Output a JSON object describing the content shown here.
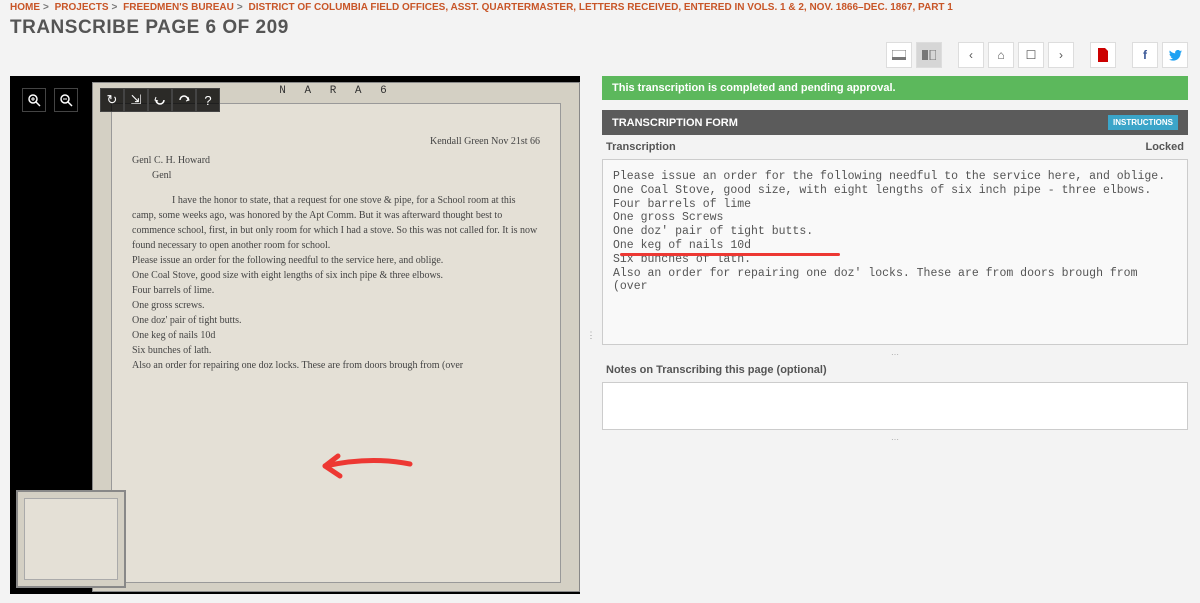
{
  "breadcrumb": {
    "items": [
      "HOME",
      "PROJECTS",
      "FREEDMEN'S BUREAU",
      "DISTRICT OF COLUMBIA FIELD OFFICES, ASST. QUARTERMASTER, LETTERS RECEIVED, ENTERED IN VOLS. 1 & 2, NOV. 1866–DEC. 1867, PART 1"
    ]
  },
  "page_title": "TRANSCRIBE PAGE 6 OF 209",
  "status": "This transcription is completed and pending approval.",
  "form_header": "TRANSCRIPTION FORM",
  "instructions_label": "INSTRUCTIONS",
  "field_label": "Transcription",
  "locked_label": "Locked",
  "notes_label": "Notes on Transcribing this page (optional)",
  "transcription_text": "Please issue an order for the following needful to the service here, and oblige.\nOne Coal Stove, good size, with eight lengths of six inch pipe - three elbows.\nFour barrels of lime\nOne gross Screws\nOne doz' pair of tight butts.\nOne keg of nails 10d\nSix bunches of lath.\nAlso an order for repairing one doz' locks. These are from doors brough from\n(over",
  "doc": {
    "nara": "N A R A       6",
    "date_line": "Kendall Green Nov 21st 66",
    "addressee": "Genl C. H. Howard",
    "title": "Genl",
    "opening": "I have the honor to",
    "body": "state, that a request for one stove & pipe, for a School room at this camp, some weeks ago, was honored by the Apt Comm. But it was afterward thought best to commence school, first, in but only room for which I had a stove. So this was not called for. It is now found necessary to open another room for school.\nPlease issue an order for the following needful to the service here, and oblige.\nOne Coal Stove, good size with eight lengths of six inch pipe & three elbows.\nFour barrels of lime.\nOne gross screws.\nOne doz' pair of tight butts.\nOne keg of nails 10d\nSix bunches of lath.\nAlso an order for repairing one doz locks. These are from doors brough from (over"
  },
  "notes_text": ""
}
